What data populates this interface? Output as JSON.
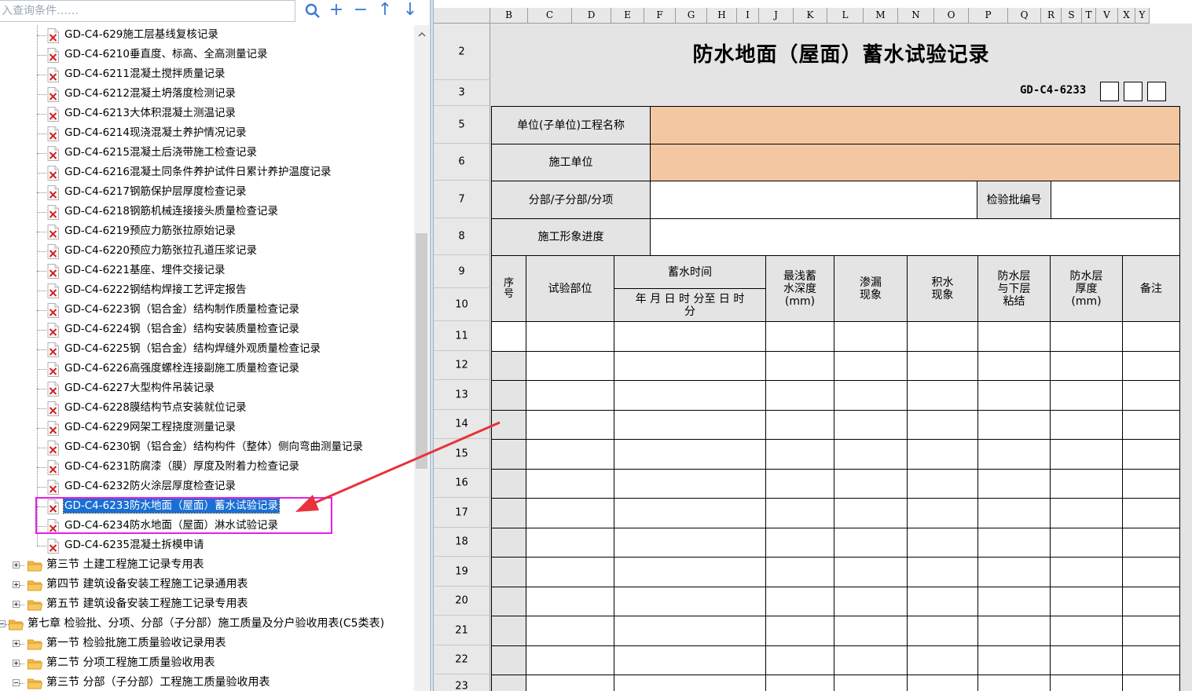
{
  "search": {
    "placeholder": "入查询条件……"
  },
  "toolbar": {
    "search": "search-icon",
    "add": "+",
    "remove": "−",
    "up": "↑",
    "down": "↓"
  },
  "tree": {
    "files": [
      "GD-C4-629施工层基线复核记录",
      "GD-C4-6210垂直度、标高、全高测量记录",
      "GD-C4-6211混凝土搅拌质量记录",
      "GD-C4-6212混凝土坍落度检测记录",
      "GD-C4-6213大体积混凝土测温记录",
      "GD-C4-6214现浇混凝土养护情况记录",
      "GD-C4-6215混凝土后浇带施工检查记录",
      "GD-C4-6216混凝土同条件养护试件日累计养护温度记录",
      "GD-C4-6217钢筋保护层厚度检查记录",
      "GD-C4-6218钢筋机械连接接头质量检查记录",
      "GD-C4-6219预应力筋张拉原始记录",
      "GD-C4-6220预应力筋张拉孔道压浆记录",
      "GD-C4-6221基座、埋件交接记录",
      "GD-C4-6222钢结构焊接工艺评定报告",
      "GD-C4-6223钢（铝合金）结构制作质量检查记录",
      "GD-C4-6224钢（铝合金）结构安装质量检查记录",
      "GD-C4-6225钢（铝合金）结构焊缝外观质量检查记录",
      "GD-C4-6226高强度螺栓连接副施工质量检查记录",
      "GD-C4-6227大型构件吊装记录",
      "GD-C4-6228膜结构节点安装就位记录",
      "GD-C4-6229网架工程挠度测量记录",
      "GD-C4-6230钢（铝合金）结构构件（整体）侧向弯曲测量记录",
      "GD-C4-6231防腐漆（膜）厚度及附着力检查记录",
      "GD-C4-6232防火涂层厚度检查记录",
      "GD-C4-6233防水地面（屋面）蓄水试验记录",
      "GD-C4-6234防水地面（屋面）淋水试验记录",
      "GD-C4-6235混凝土拆模申请"
    ],
    "selected_index": 24,
    "sections": [
      "第三节 土建工程施工记录专用表",
      "第四节 建筑设备安装工程施工记录通用表",
      "第五节 建筑设备安装工程施工记录专用表"
    ],
    "chapter": "第七章 检验批、分项、分部（子分部）施工质量及分户验收用表(C5类表)",
    "sub_sections": [
      "第一节 检验批施工质量验收记录用表",
      "第二节 分项工程施工质量验收用表",
      "第三节 分部（子分部）工程施工质量验收用表"
    ]
  },
  "sheet": {
    "columns": [
      "B",
      "C",
      "D",
      "E",
      "F",
      "G",
      "H",
      "I",
      "J",
      "K",
      "L",
      "M",
      "N",
      "O",
      "P",
      "Q",
      "R",
      "S",
      "T",
      "V",
      "X",
      "Y"
    ],
    "rows": [
      "2",
      "3",
      "5",
      "6",
      "7",
      "8",
      "9",
      "10",
      "11",
      "12",
      "13",
      "14",
      "15",
      "16",
      "17",
      "18",
      "19",
      "20",
      "21",
      "22",
      "23"
    ],
    "form": {
      "title": "防水地面（屋面）蓄水试验记录",
      "code": "GD-C4-6233",
      "unit_project_label": "单位(子单位)工程名称",
      "construction_unit_label": "施工单位",
      "division_label": "分部/子分部/分项",
      "batch_no_label": "检验批编号",
      "progress_label": "施工形象进度",
      "headers": {
        "seq": "序号",
        "location": "试验部位",
        "time": "蓄水时间",
        "time_detail": "年 月 日 时 分至 日 时 分",
        "min_depth": "最浅蓄水深度(mm)",
        "leak": "渗漏现象",
        "ponding": "积水现象",
        "bond": "防水层与下层粘结",
        "thickness": "防水层厚度(mm)",
        "remark": "备注"
      }
    }
  },
  "colors": {
    "highlight": "#e81ee8",
    "selection": "#1a6fd4",
    "orange_field": "#f3c7a2",
    "arrow": "#e8323c"
  }
}
